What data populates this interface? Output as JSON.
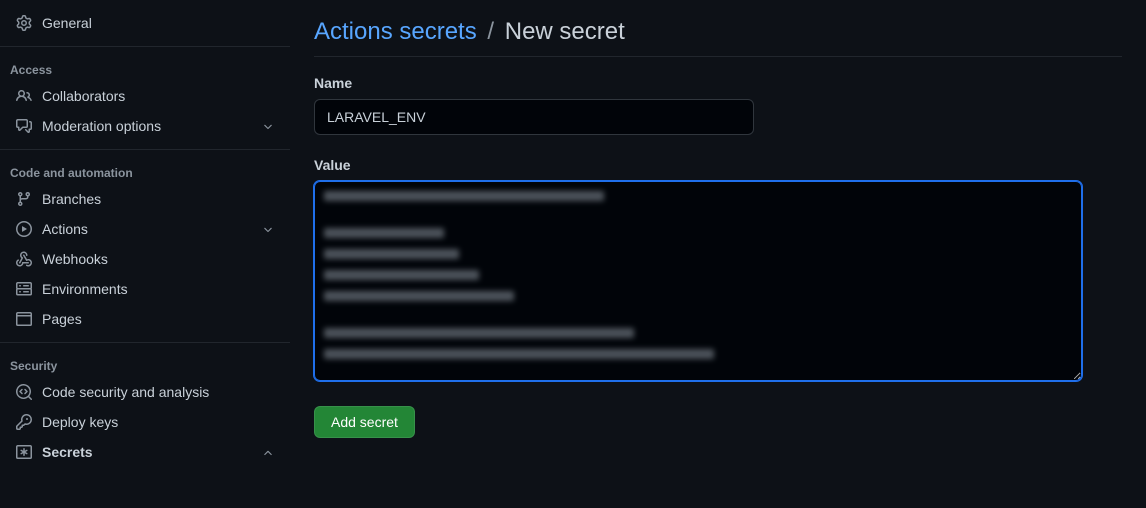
{
  "sidebar": {
    "general": {
      "label": "General"
    },
    "group_access": {
      "title": "Access"
    },
    "collaborators": {
      "label": "Collaborators"
    },
    "moderation": {
      "label": "Moderation options"
    },
    "group_code": {
      "title": "Code and automation"
    },
    "branches": {
      "label": "Branches"
    },
    "actions": {
      "label": "Actions"
    },
    "webhooks": {
      "label": "Webhooks"
    },
    "environments": {
      "label": "Environments"
    },
    "pages": {
      "label": "Pages"
    },
    "group_security": {
      "title": "Security"
    },
    "code_security": {
      "label": "Code security and analysis"
    },
    "deploy_keys": {
      "label": "Deploy keys"
    },
    "secrets": {
      "label": "Secrets"
    }
  },
  "heading": {
    "crumb_link": "Actions secrets",
    "crumb_sep": "/",
    "crumb_current": "New secret"
  },
  "form": {
    "name_label": "Name",
    "name_value": "LARAVEL_ENV",
    "value_label": "Value",
    "submit_label": "Add secret"
  }
}
